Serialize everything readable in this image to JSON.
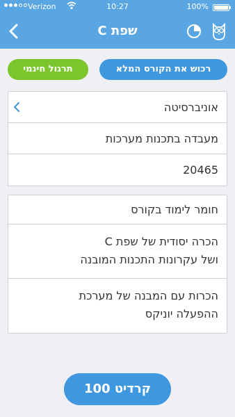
{
  "status_bar": {
    "carrier": "Verizon",
    "time": "10:27",
    "battery": "100%",
    "signal_bars": 3,
    "signal_total": 5
  },
  "nav": {
    "title": "שפת C",
    "icons": [
      "chevron-left-icon",
      "pie-chart-icon",
      "owl-icon"
    ]
  },
  "actions": {
    "free_practice_label": "תרגול חינמי",
    "buy_course_label": "רכוש את הקורס המלא"
  },
  "course_info": {
    "university": "אוניברסיטה",
    "lab": "מעבדה בתכנות מערכות",
    "course_number": "20465"
  },
  "study_material": {
    "header": "חומר לימוד בקורס",
    "item1_line1": "הכרה יסודית של שפת C",
    "item1_line2": "ושל עקרונות התכנות המובנה",
    "item2_line1": "הכרות עם המבנה של מערכת",
    "item2_line2": "ההפעלה יוניקס"
  },
  "credit": {
    "label": "קרדיט 100"
  },
  "colors": {
    "primary_blue": "#5aa6e2",
    "button_blue": "#3f97df",
    "button_green": "#7cc62d",
    "background": "#efeff4"
  }
}
